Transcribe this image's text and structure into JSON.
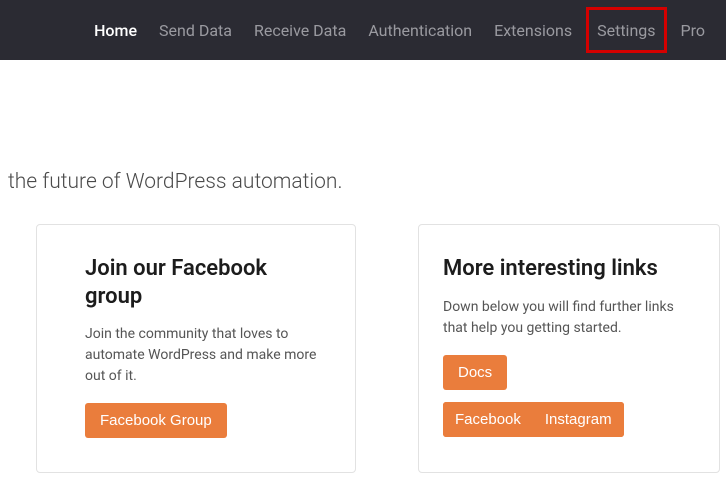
{
  "nav": {
    "items": [
      {
        "label": "Home",
        "active": true
      },
      {
        "label": "Send Data"
      },
      {
        "label": "Receive Data"
      },
      {
        "label": "Authentication"
      },
      {
        "label": "Extensions"
      },
      {
        "label": "Settings",
        "highlighted": true
      },
      {
        "label": "Pro"
      }
    ]
  },
  "tagline": "the future of WordPress automation.",
  "cards": {
    "facebook_group": {
      "title": "Join our Facebook group",
      "text": "Join the community that loves to automate WordPress and make more out of it.",
      "button": "Facebook Group"
    },
    "links": {
      "title": "More interesting links",
      "text": "Down below you will find further links that help you getting started.",
      "buttons": [
        "Docs",
        "Facebook",
        "Instagram"
      ]
    }
  }
}
